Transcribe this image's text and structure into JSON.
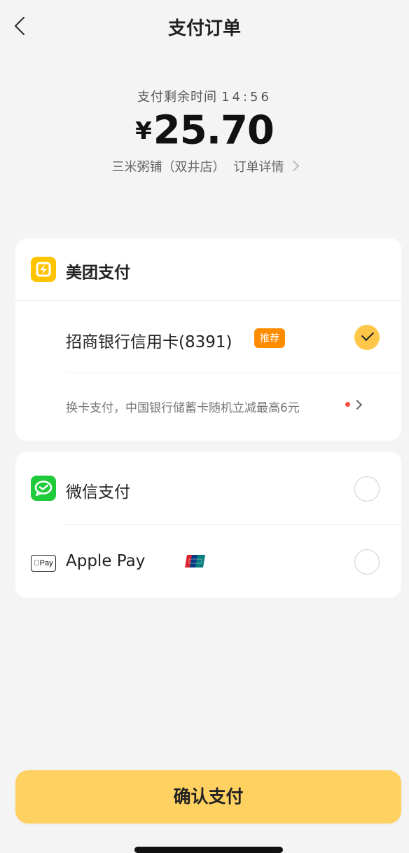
{
  "nav": {
    "title": "支付订单"
  },
  "summary": {
    "countdown_label": "支付剩余时间",
    "countdown_time": "14:56",
    "currency": "¥",
    "amount": "25.70",
    "merchant": "三米粥铺（双井店）",
    "detail_link": "订单详情"
  },
  "meituan_pay": {
    "title": "美团支付",
    "card_label": "招商银行信用卡(8391)",
    "tag": "推荐",
    "selected": true,
    "promo": "换卡支付，中国银行储蓄卡随机立减最高6元"
  },
  "other_methods": [
    {
      "label": "微信支付",
      "icon": "wechat-pay-icon",
      "selected": false
    },
    {
      "label": "Apple Pay",
      "icon": "apple-pay-icon",
      "badge_icon": "unionpay-icon",
      "badge_text": "Pay",
      "selected": false
    }
  ],
  "confirm_label": "确认支付",
  "colors": {
    "background": "#f4f4f4",
    "accent": "#ffd161",
    "check": "#ffc74a",
    "meituan_yellow": "#ffc300",
    "tag_orange": "#ff8b00",
    "wechat_green": "#1fcb3b",
    "red_dot": "#ff4a3d"
  }
}
